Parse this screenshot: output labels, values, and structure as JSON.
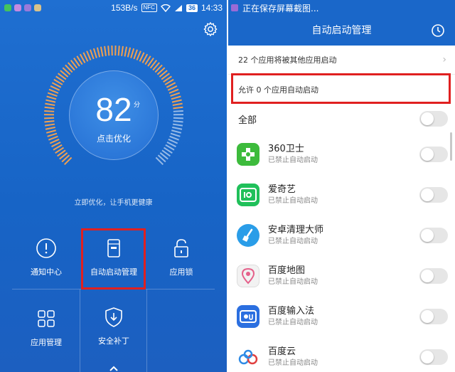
{
  "left": {
    "status": {
      "speed": "153B/s",
      "nfc": "NFC",
      "battery": "36",
      "time": "14:33"
    },
    "score": "82",
    "score_unit": "分",
    "optimize_label": "点击优化",
    "hint": "立即优化，让手机更健康",
    "tiles": [
      {
        "label": "通知中心",
        "icon": "alert-circle-icon"
      },
      {
        "label": "自动启动管理",
        "icon": "card-icon"
      },
      {
        "label": "应用锁",
        "icon": "lock-icon"
      },
      {
        "label": "应用管理",
        "icon": "grid-icon"
      },
      {
        "label": "安全补丁",
        "icon": "shield-download-icon"
      }
    ],
    "colors": {
      "background": "#1f6fd1",
      "gauge": "#f0a050",
      "highlight": "#e02020"
    }
  },
  "right": {
    "status_text": "正在保存屏幕截图...",
    "title": "自动启动管理",
    "others_row": "22 个应用将被其他应用启动",
    "allowed_row": "允许 0 个应用自动启动",
    "all_label": "全部",
    "apps": [
      {
        "name": "360卫士",
        "status": "已禁止自动启动",
        "icon": "plus-cross-icon",
        "color": "#3dbb3c"
      },
      {
        "name": "爱奇艺",
        "status": "已禁止自动启动",
        "icon": "iqiyi-icon",
        "color": "#20c05a"
      },
      {
        "name": "安卓清理大师",
        "status": "已禁止自动启动",
        "icon": "broom-icon",
        "color": "#2a9de8"
      },
      {
        "name": "百度地图",
        "status": "已禁止自动启动",
        "icon": "map-pin-icon",
        "color": "#f2f2f2"
      },
      {
        "name": "百度输入法",
        "status": "已禁止自动启动",
        "icon": "keyboard-du-icon",
        "color": "#2b6fe0"
      },
      {
        "name": "百度云",
        "status": "已禁止自动启动",
        "icon": "cloud-icon",
        "color": "#ffffff"
      }
    ]
  }
}
